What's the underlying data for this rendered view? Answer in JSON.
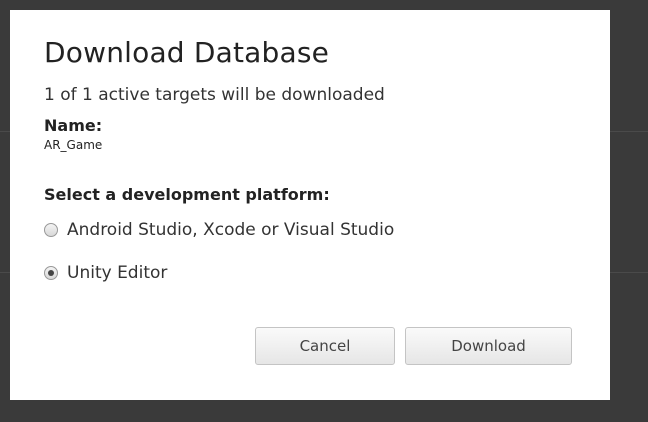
{
  "dialog": {
    "title": "Download Database",
    "subtitle": "1 of 1 active targets will be downloaded",
    "name_label": "Name:",
    "name_value": "AR_Game",
    "platform_label": "Select a development platform:",
    "options": [
      {
        "label": "Android Studio, Xcode or Visual Studio",
        "selected": false
      },
      {
        "label": "Unity Editor",
        "selected": true
      }
    ],
    "cancel_label": "Cancel",
    "download_label": "Download"
  }
}
